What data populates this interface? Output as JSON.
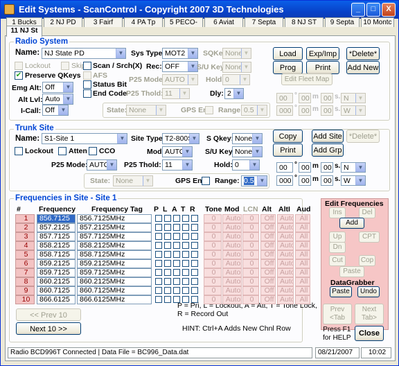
{
  "window": {
    "title": "Edit Systems - ScanControl - Copyright 2007 3D Technologies",
    "controls": [
      "_",
      "□",
      "X"
    ]
  },
  "tabs": [
    "1 Bucks",
    "2 NJ PD",
    "3 Fairf",
    "4 PA Tp",
    "5 PECO-",
    "6 Aviat",
    "7 Septa",
    "8 NJ ST",
    "9 Septa",
    "10 Montc",
    "11 NJ St"
  ],
  "radio": {
    "title": "Radio System",
    "name_label": "Name:",
    "name": "NJ State PD",
    "sys_type_label": "Sys Type:",
    "sys_type": "MOT2",
    "sqkey_label": "SQKey:",
    "sqkey": "None",
    "lockout": "Lockout",
    "skip": "Skip",
    "preserve": "Preserve QKeys",
    "scan": "Scan / Srch(X)",
    "rec_label": "Rec:",
    "rec": "OFF",
    "su_label": "S/U Key:",
    "su": "None",
    "emg_label": "Emg Alt:",
    "emg": "Off",
    "afs": "AFS",
    "p25mode_label": "P25 Mode:",
    "p25mode": "AUTO",
    "hold_label": "Hold:",
    "hold": "0",
    "altlvl_label": "Alt Lvl:",
    "altlvl": "Auto",
    "status_bit": "Status Bit",
    "end_code": "End Code",
    "p25thold_label": "P25 Thold:",
    "p25thold": "11",
    "dly_label": "Dly:",
    "dly": "2",
    "icall_label": "I-Call:",
    "icall": "Off",
    "state_label": "State:",
    "state": "None",
    "gps_label": "GPS En:",
    "range_label": "Range:",
    "range": "0.5",
    "load": "Load",
    "expimp": "Exp/Imp",
    "delete": "*Delete*",
    "prog": "Prog",
    "print": "Print",
    "addnew": "Add New",
    "editfleet": "Edit Fleet Map",
    "lat": [
      "00",
      "00",
      "00",
      "N"
    ],
    "lon": [
      "000",
      "00",
      "00",
      "W"
    ]
  },
  "trunk": {
    "title": "Trunk Site",
    "name_label": "Name:",
    "name": "S1-Site 1",
    "site_type_label": "Site Type:",
    "site_type": "T2-800S",
    "sqkey_label": "S Qkey:",
    "sqkey": "None",
    "lockout": "Lockout",
    "atten": "Atten",
    "cco": "CCO",
    "mod_label": "Mod:",
    "mod": "AUTO",
    "su_label": "S/U Key:",
    "su": "None",
    "p25mode_label": "P25 Mode:",
    "p25mode": "AUTO",
    "p25thold_label": "P25 Thold:",
    "p25thold": "11",
    "hold_label": "Hold:",
    "hold": "0",
    "state_label": "State:",
    "state": "None",
    "gps_label": "GPS En:",
    "range_label": "Range:",
    "range": "0.5",
    "copy": "Copy",
    "addsite": "Add Site",
    "delete": "*Delete*",
    "print": "Print",
    "addgrp": "Add Grp",
    "lat": [
      "00",
      "00",
      "00",
      "N"
    ],
    "lon": [
      "000",
      "00",
      "00",
      "W"
    ]
  },
  "freq": {
    "title": "Frequencies in Site - Site 1",
    "cols": [
      "#",
      "Frequency",
      "Frequency Tag",
      "P",
      "L",
      "A",
      "T",
      "R",
      "Tone",
      "Mod",
      "LCN",
      "Alt",
      "AltI",
      "Aud"
    ],
    "rows": [
      {
        "n": "1",
        "f": "856.7125",
        "tag": "856.7125MHz"
      },
      {
        "n": "2",
        "f": "857.2125",
        "tag": "857.2125MHz"
      },
      {
        "n": "3",
        "f": "857.7125",
        "tag": "857.7125MHz"
      },
      {
        "n": "4",
        "f": "858.2125",
        "tag": "858.2125MHz"
      },
      {
        "n": "5",
        "f": "858.7125",
        "tag": "858.7125MHz"
      },
      {
        "n": "6",
        "f": "859.2125",
        "tag": "859.2125MHz"
      },
      {
        "n": "7",
        "f": "859.7125",
        "tag": "859.7125MHz"
      },
      {
        "n": "8",
        "f": "860.2125",
        "tag": "860.2125MHz"
      },
      {
        "n": "9",
        "f": "860.7125",
        "tag": "860.7125MHz"
      },
      {
        "n": "10",
        "f": "866.6125",
        "tag": "866.6125MHz"
      }
    ],
    "row_defaults": {
      "tone": "0",
      "mod": "Auto",
      "lcn": "0",
      "alt": "Off",
      "alti": "Auto",
      "aud": "All"
    },
    "legend1": "P = Pri, L = Lockout, A = Att, T = Tone Lock,",
    "legend2": "R = Record Out",
    "hint": "HINT:  Ctrl+A Adds New Chnl Row",
    "prev10": "<< Prev 10",
    "next10": "Next 10 >>"
  },
  "editfreq": {
    "title": "Edit Frequencies",
    "ins": "Ins",
    "del": "Del",
    "add": "Add",
    "up": "Up",
    "dn": "Dn",
    "cpt": "CPT",
    "cut": "Cut",
    "cop": "Cop",
    "paste": "Paste",
    "dg_title": "DataGrabber",
    "dg_paste": "Paste",
    "dg_undo": "Undo"
  },
  "nav": {
    "prev": "Prev\n<Tab",
    "next": "Next\nTab>",
    "help": "Press F1\nfor HELP",
    "close": "Close"
  },
  "status": {
    "msg": "Radio BCD996T Connected | Data File = BC996_Data.dat",
    "date": "08/21/2007",
    "time": "10:02"
  }
}
